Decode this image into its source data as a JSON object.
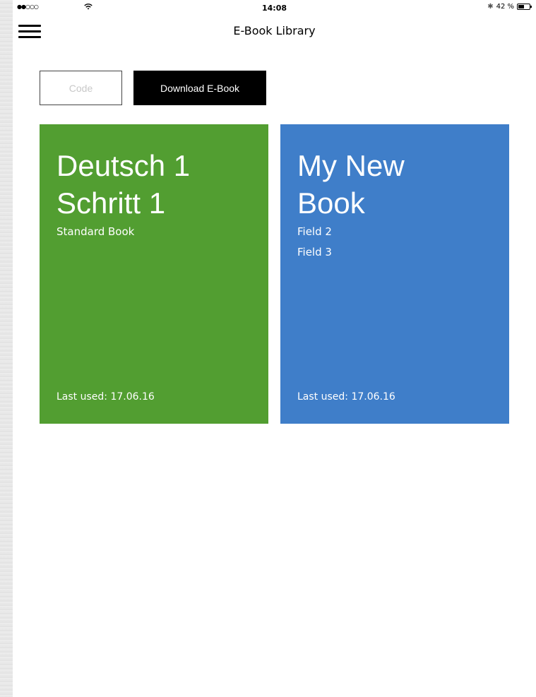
{
  "status_bar": {
    "signal": "●●○○○",
    "time": "14:08",
    "bluetooth": "✱",
    "battery_percent": "42 %"
  },
  "nav": {
    "title": "E-Book Library"
  },
  "actions": {
    "code_placeholder": "Code",
    "download_label": "Download E-Book"
  },
  "books": [
    {
      "title_line1": "Deutsch 1",
      "title_line2": "Schritt 1",
      "fields": [
        "Standard Book"
      ],
      "last_used": "Last used: 17.06.16",
      "color": "#529e31"
    },
    {
      "title_line1": "My New",
      "title_line2": "Book",
      "fields": [
        "Field 2",
        "Field 3"
      ],
      "last_used": "Last used: 17.06.16",
      "color": "#3f7ec9"
    }
  ]
}
